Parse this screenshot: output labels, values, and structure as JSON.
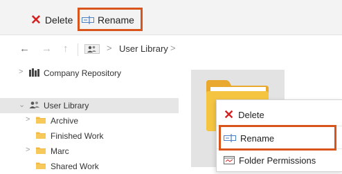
{
  "toolbar": {
    "delete_label": "Delete",
    "rename_label": "Rename"
  },
  "nav": {
    "back_icon": "←",
    "forward_icon": "→",
    "up_icon": "↑",
    "crumb_sep": ">",
    "crumb_label": "User Library"
  },
  "sidebar": {
    "items": [
      {
        "label": "Company Repository",
        "chevron": ">"
      },
      {
        "label": "User Library",
        "chevron": "⌄"
      },
      {
        "label": "Archive",
        "chevron": ">"
      },
      {
        "label": "Finished Work",
        "chevron": ""
      },
      {
        "label": "Marc",
        "chevron": ">"
      },
      {
        "label": "Shared Work",
        "chevron": ""
      }
    ]
  },
  "context_menu": {
    "delete_label": "Delete",
    "rename_label": "Rename",
    "permissions_label": "Folder Permissions"
  },
  "colors": {
    "highlight": "#d9541a",
    "delete_red": "#d42020",
    "folder_yellow": "#f5c542"
  }
}
